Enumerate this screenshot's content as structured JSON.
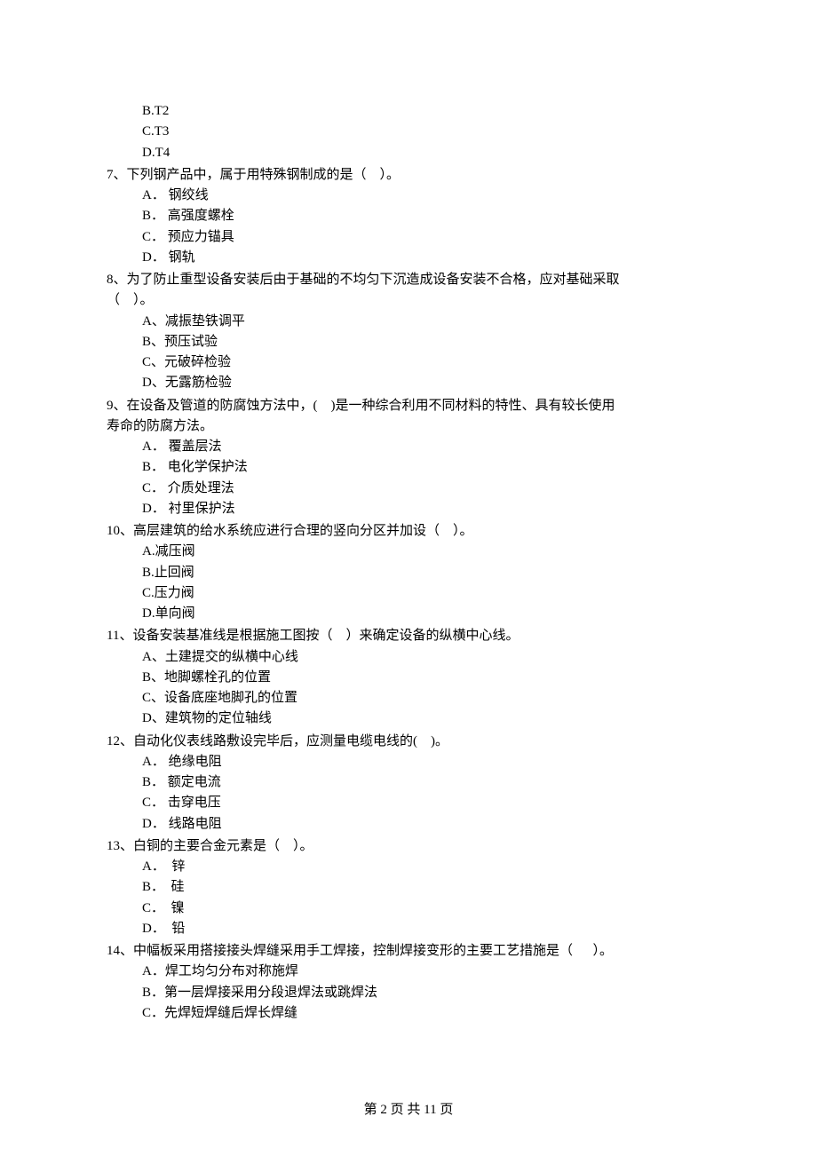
{
  "orphan_options": [
    "B.T2",
    "C.T3",
    "D.T4"
  ],
  "questions": [
    {
      "stem": "7、下列钢产品中，属于用特殊钢制成的是（    ）。",
      "options": [
        "A． 钢绞线",
        "B． 高强度螺栓",
        "C． 预应力锚具",
        "D． 钢轨"
      ]
    },
    {
      "stem": "8、为了防止重型设备安装后由于基础的不均匀下沉造成设备安装不合格，应对基础采取\n（    ）。",
      "options": [
        "A、减振垫铁调平",
        "B、预压试验",
        "C、元破碎检验",
        "D、无露筋检验"
      ]
    },
    {
      "stem": "9、在设备及管道的防腐蚀方法中，(    )是一种综合利用不同材料的特性、具有较长使用\n寿命的防腐方法。",
      "options": [
        "A． 覆盖层法",
        "B． 电化学保护法",
        "C． 介质处理法",
        "D． 衬里保护法"
      ]
    },
    {
      "stem": "10、高层建筑的给水系统应进行合理的竖向分区并加设（    ）。",
      "options": [
        "A.减压阀",
        "B.止回阀",
        "C.压力阀",
        "D.单向阀"
      ]
    },
    {
      "stem": "11、设备安装基准线是根据施工图按（    ）来确定设备的纵横中心线。",
      "options": [
        "A、土建提交的纵横中心线",
        "B、地脚螺栓孔的位置",
        "C、设备底座地脚孔的位置",
        "D、建筑物的定位轴线"
      ]
    },
    {
      "stem": "12、自动化仪表线路敷设完毕后，应测量电缆电线的(    )。",
      "options": [
        "A． 绝缘电阻",
        "B． 额定电流",
        "C． 击穿电压",
        "D． 线路电阻"
      ]
    },
    {
      "stem": "13、白铜的主要合金元素是（    ）。",
      "options": [
        "A．  锌",
        "B．  硅",
        "C．  镍",
        "D．  铅"
      ]
    },
    {
      "stem": "14、中幅板采用搭接接头焊缝采用手工焊接，控制焊接变形的主要工艺措施是（      ）。",
      "options": [
        "A．焊工均匀分布对称施焊",
        "B．第一层焊接采用分段退焊法或跳焊法",
        "C．先焊短焊缝后焊长焊缝"
      ]
    }
  ],
  "footer": "第 2 页 共 11 页"
}
